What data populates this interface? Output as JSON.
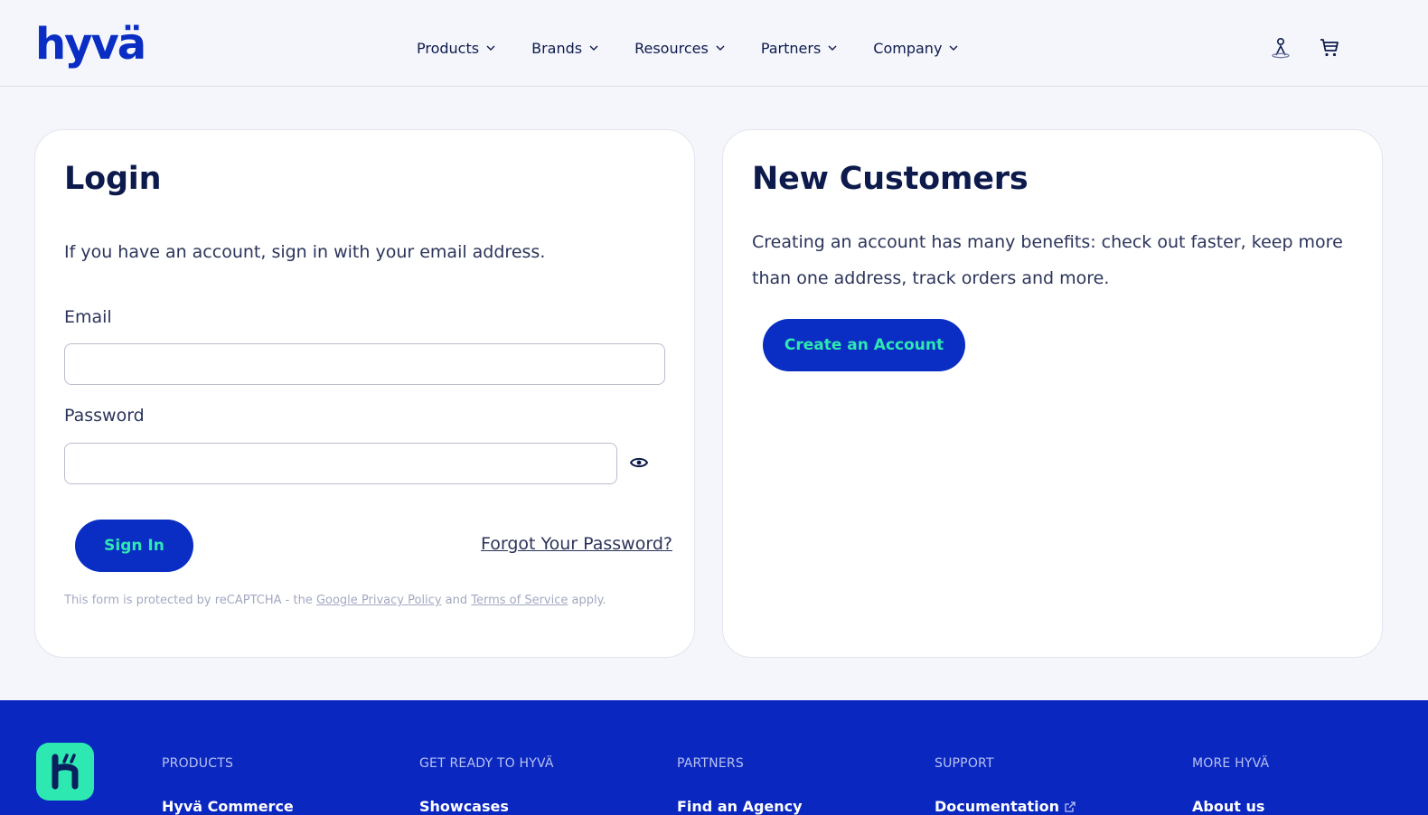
{
  "header": {
    "logo_text": "hyvä",
    "nav": [
      {
        "label": "Products"
      },
      {
        "label": "Brands"
      },
      {
        "label": "Resources"
      },
      {
        "label": "Partners"
      },
      {
        "label": "Company"
      }
    ],
    "icons": [
      "account-icon",
      "cart-icon"
    ]
  },
  "login": {
    "title": "Login",
    "intro": "If you have an account, sign in with your email address.",
    "email_label": "Email",
    "email_value": "",
    "password_label": "Password",
    "password_value": "",
    "show_password_icon": "eye-icon",
    "sign_in_label": "Sign In",
    "forgot_label": "Forgot Your Password?",
    "recaptcha": {
      "prefix": "This form is protected by reCAPTCHA - the ",
      "privacy_link": "Google Privacy Policy",
      "and": " and ",
      "terms_link": "Terms of Service",
      "suffix": " apply."
    }
  },
  "new_customers": {
    "title": "New Customers",
    "intro": "Creating an account has many benefits: check out faster, keep more than one address, track orders and more.",
    "create_label": "Create an Account"
  },
  "footer": {
    "columns": [
      {
        "heading": "PRODUCTS",
        "first_link": "Hyvä Commerce"
      },
      {
        "heading": "GET READY TO HYVÄ",
        "first_link": "Showcases"
      },
      {
        "heading": "PARTNERS",
        "first_link": "Find an Agency"
      },
      {
        "heading": "SUPPORT",
        "first_link": "Documentation"
      },
      {
        "heading": "MORE HYVÄ",
        "first_link": "About us"
      }
    ]
  },
  "colors": {
    "brand_blue": "#0a2ec4",
    "accent_mint": "#2ee8b1",
    "text_dark": "#0d1b4c",
    "page_bg": "#f5f6fc"
  }
}
